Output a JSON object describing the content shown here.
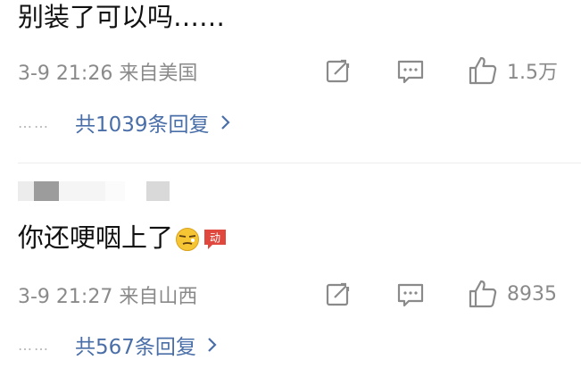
{
  "comments": [
    {
      "text": "别装了可以吗……",
      "meta": "3-9 21:26 来自美国",
      "likes": "1.5万",
      "replies": "共1039条回复"
    },
    {
      "text": "你还哽咽上了",
      "meta": "3-9 21:27 来自山西",
      "likes": "8935",
      "replies": "共567条回复"
    }
  ],
  "dots": "……",
  "emoji": {
    "badge_text": "动",
    "face_color": "#f6c533",
    "badge_color": "#e0483d"
  },
  "colors": {
    "link": "#4a6fa8",
    "meta": "#8a8a8a",
    "text": "#111111"
  }
}
